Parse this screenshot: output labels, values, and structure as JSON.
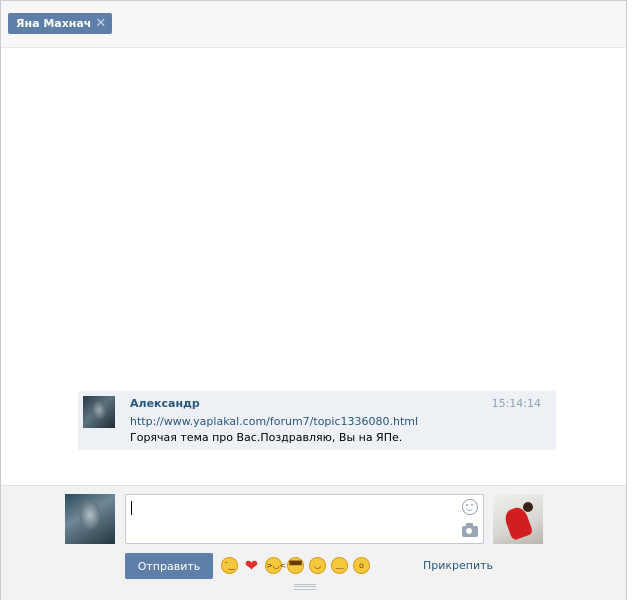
{
  "tab": {
    "label": "Яна Махнач",
    "close_glyph": "✕"
  },
  "message": {
    "author": "Александр",
    "time": "15:14:14",
    "link": "http://www.yaplakal.com/forum7/topic1336080.html",
    "text": "Горячая тема про Вас.Поздравляю, Вы на ЯПе."
  },
  "composer": {
    "send_label": "Отправить",
    "attach_label": "Прикрепить",
    "input_value": "",
    "emojis": [
      {
        "name": "wink-emoji",
        "glyph": "😉"
      },
      {
        "name": "heart-emoji",
        "glyph": "❤"
      },
      {
        "name": "laugh-emoji",
        "glyph": "😆"
      },
      {
        "name": "sunglasses-emoji",
        "glyph": "😎"
      },
      {
        "name": "smile-emoji",
        "glyph": "😊"
      },
      {
        "name": "sweat-emoji",
        "glyph": "😓"
      },
      {
        "name": "shocked-emoji",
        "glyph": "😨"
      }
    ]
  },
  "colors": {
    "accent": "#5e7fa8",
    "link": "#2b587a",
    "message_bg": "#edf0f5"
  }
}
